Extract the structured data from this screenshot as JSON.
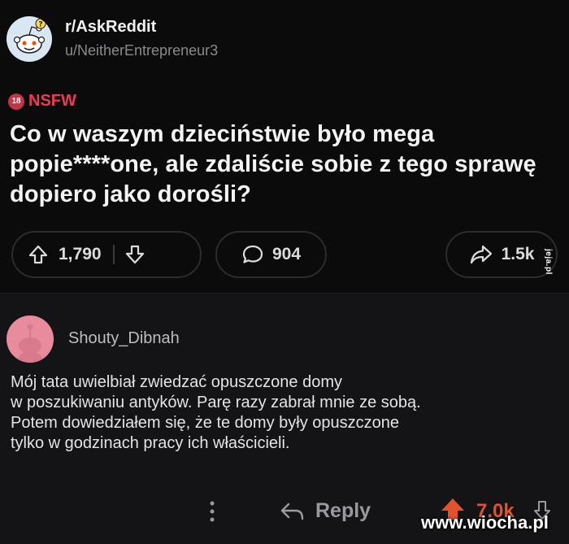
{
  "post": {
    "subreddit": "r/AskReddit",
    "author": "u/NeitherEntrepreneur3",
    "nsfw_badge": "18",
    "nsfw_label": "NSFW",
    "title": "Co w waszym dzieciństwie było mega popie****one, ale zdaliście sobie z tego sprawę dopiero jako dorośli?",
    "upvotes": "1,790",
    "comments": "904",
    "shares": "1.5k"
  },
  "comment": {
    "username": "Shouty_Dibnah",
    "text": "Mój tata uwielbiał zwiedzać opuszczone domy\nw poszukiwaniu antyków. Parę razy zabrał mnie ze sobą.\nPotem dowiedziałem się, że te domy były opuszczone\ntylko w godzinach pracy ich właścicieli.",
    "reply_label": "Reply",
    "score": "7.0k"
  },
  "watermarks": {
    "side": "jeja.pl",
    "bottom": "www.wiocha.pl"
  },
  "colors": {
    "nsfw": "#ee3a55",
    "upvote_active": "#e2522c",
    "background": "#0b0b0c"
  },
  "icons": [
    "snoo-icon",
    "upvote-icon",
    "downvote-icon",
    "comment-icon",
    "share-icon",
    "more-icon",
    "reply-icon"
  ]
}
